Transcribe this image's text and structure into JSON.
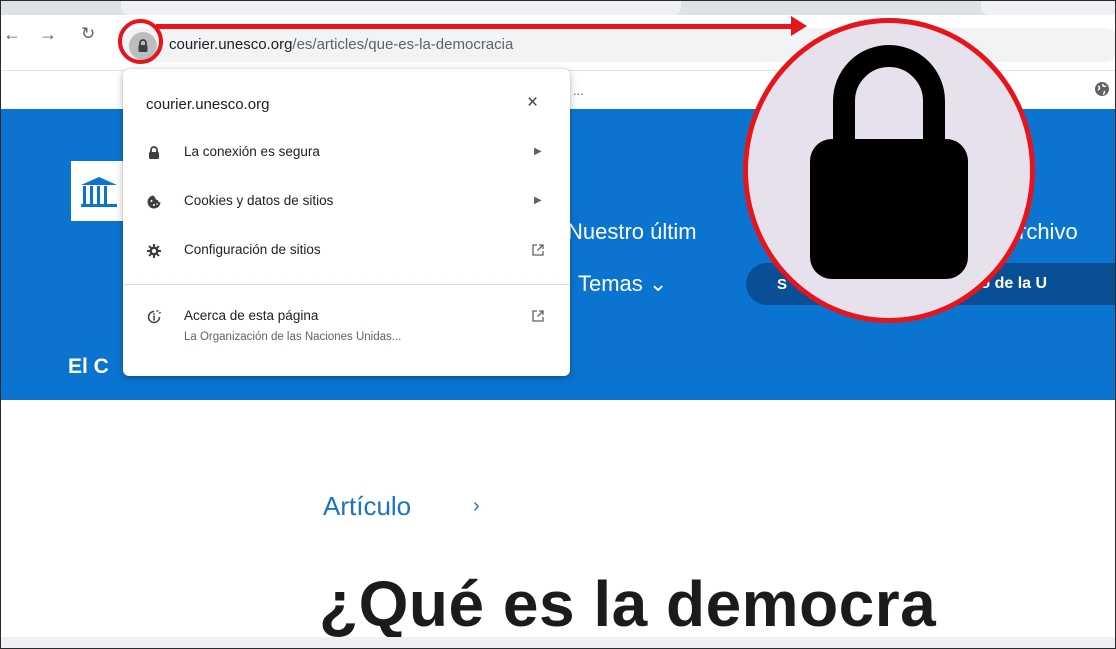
{
  "browser": {
    "url_host": "courier.unesco.org",
    "url_path": "/es/articles/que-es-la-democracia",
    "bookmark_overflow": "..."
  },
  "page": {
    "nav_latest": "Nuestro últim",
    "nav_archive": "rchivo",
    "nav_topics": "Temas ⌄",
    "pill_left": "S",
    "pill_right": "rreo de la U",
    "site_name_partial": "El C",
    "breadcrumb": "Artículo",
    "breadcrumb_arrow": "›",
    "headline": "¿Qué es la democra"
  },
  "site_info_popup": {
    "title": "courier.unesco.org",
    "close_label": "×",
    "items": [
      {
        "label": "La conexión es segura",
        "icon": "lock-icon",
        "trailing": "arrow"
      },
      {
        "label": "Cookies y datos de sitios",
        "icon": "cookie-icon",
        "trailing": "arrow"
      },
      {
        "label": "Configuración de sitios",
        "icon": "gear-icon",
        "trailing": "external"
      }
    ],
    "about": {
      "label": "Acerca de esta página",
      "subtitle": "La Organización de las Naciones Unidas...",
      "icon": "about-page-icon",
      "trailing": "external"
    }
  },
  "annotation": {
    "color": "#e8141b",
    "magnified_icon": "lock-icon"
  },
  "colors": {
    "hero_blue": "#0b74d1",
    "pill_dark_blue": "#0a4f95",
    "link_blue": "#1a73c8"
  }
}
